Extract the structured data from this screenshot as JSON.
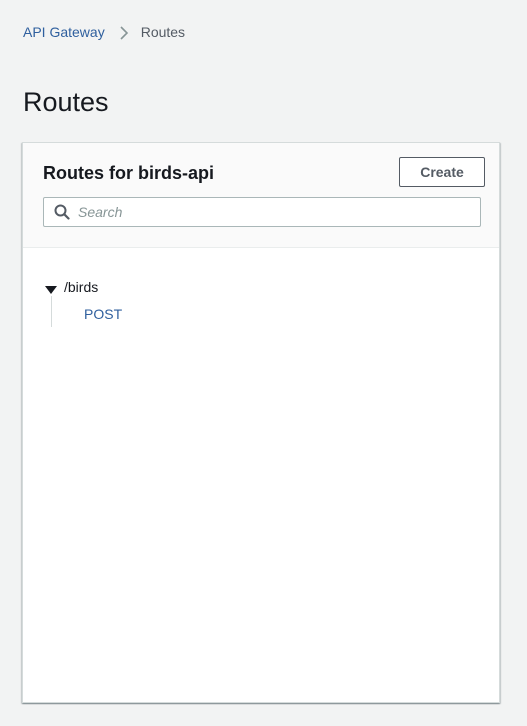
{
  "breadcrumb": {
    "parent": "API Gateway",
    "current": "Routes"
  },
  "page": {
    "title": "Routes"
  },
  "panel": {
    "title": "Routes for birds-api",
    "create_label": "Create",
    "search": {
      "placeholder": "Search",
      "value": ""
    },
    "tree": {
      "resource": "/birds",
      "expanded": true,
      "methods": [
        "POST"
      ]
    }
  },
  "colors": {
    "link": "#2f5f9e",
    "background": "#f2f3f3",
    "panel_header": "#fafafa"
  },
  "icons": {
    "breadcrumb_separator": "chevron-right-icon",
    "search": "search-icon",
    "tree_toggle": "caret-down-icon"
  }
}
